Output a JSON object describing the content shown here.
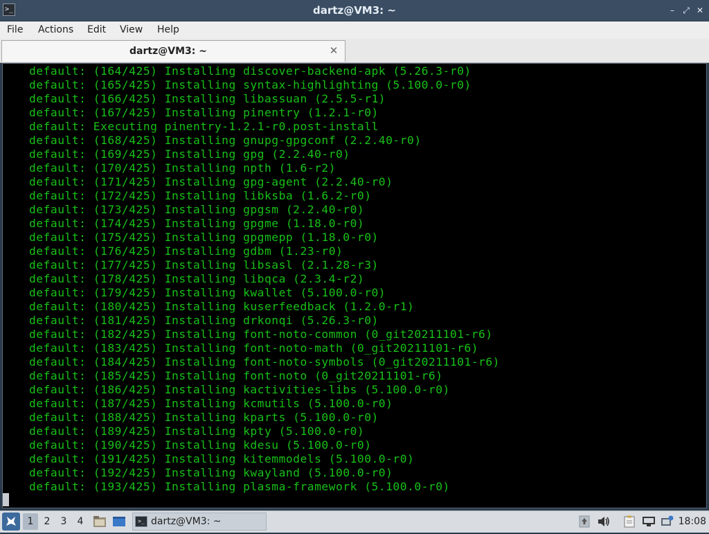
{
  "window": {
    "title": "dartz@VM3: ~",
    "controls": {
      "minimize": "–",
      "maximize": "⤢",
      "close": "✕"
    }
  },
  "menu": [
    "File",
    "Actions",
    "Edit",
    "View",
    "Help"
  ],
  "tab": {
    "label": "dartz@VM3: ~",
    "close": "✕"
  },
  "terminal": {
    "lines": [
      "default: (164/425) Installing discover-backend-apk (5.26.3-r0)",
      "default: (165/425) Installing syntax-highlighting (5.100.0-r0)",
      "default: (166/425) Installing libassuan (2.5.5-r1)",
      "default: (167/425) Installing pinentry (1.2.1-r0)",
      "default: Executing pinentry-1.2.1-r0.post-install",
      "default: (168/425) Installing gnupg-gpgconf (2.2.40-r0)",
      "default: (169/425) Installing gpg (2.2.40-r0)",
      "default: (170/425) Installing npth (1.6-r2)",
      "default: (171/425) Installing gpg-agent (2.2.40-r0)",
      "default: (172/425) Installing libksba (1.6.2-r0)",
      "default: (173/425) Installing gpgsm (2.2.40-r0)",
      "default: (174/425) Installing gpgme (1.18.0-r0)",
      "default: (175/425) Installing gpgmepp (1.18.0-r0)",
      "default: (176/425) Installing gdbm (1.23-r0)",
      "default: (177/425) Installing libsasl (2.1.28-r3)",
      "default: (178/425) Installing libqca (2.3.4-r2)",
      "default: (179/425) Installing kwallet (5.100.0-r0)",
      "default: (180/425) Installing kuserfeedback (1.2.0-r1)",
      "default: (181/425) Installing drkonqi (5.26.3-r0)",
      "default: (182/425) Installing font-noto-common (0_git20211101-r6)",
      "default: (183/425) Installing font-noto-math (0_git20211101-r6)",
      "default: (184/425) Installing font-noto-symbols (0_git20211101-r6)",
      "default: (185/425) Installing font-noto (0_git20211101-r6)",
      "default: (186/425) Installing kactivities-libs (5.100.0-r0)",
      "default: (187/425) Installing kcmutils (5.100.0-r0)",
      "default: (188/425) Installing kparts (5.100.0-r0)",
      "default: (189/425) Installing kpty (5.100.0-r0)",
      "default: (190/425) Installing kdesu (5.100.0-r0)",
      "default: (191/425) Installing kitemmodels (5.100.0-r0)",
      "default: (192/425) Installing kwayland (5.100.0-r0)",
      "default: (193/425) Installing plasma-framework (5.100.0-r0)"
    ],
    "text_color": "#18c018"
  },
  "taskbar": {
    "workspaces": [
      "1",
      "2",
      "3",
      "4"
    ],
    "active_workspace": "1",
    "task_label": "dartz@VM3: ~",
    "clock": "18:08"
  }
}
